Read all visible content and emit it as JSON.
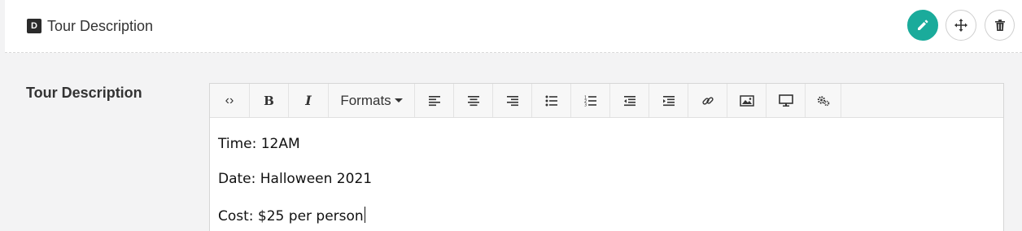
{
  "header": {
    "badge": "D",
    "title": "Tour Description",
    "buttons": {
      "edit": "pencil-icon",
      "move": "move-arrows-icon",
      "delete": "trash-icon"
    },
    "accent": "#1aab9b"
  },
  "field": {
    "label": "Tour Description",
    "toolbar": {
      "code": "‹›",
      "bold": "B",
      "italic": "I",
      "formats": "Formats",
      "icons": [
        "align-left-icon",
        "align-center-icon",
        "align-right-icon",
        "bullet-list-icon",
        "numbered-list-icon",
        "outdent-icon",
        "indent-icon",
        "link-icon",
        "image-icon",
        "embed-media-icon",
        "settings-icon"
      ]
    },
    "lines": [
      "Time: 12AM",
      "Date: Halloween 2021",
      "Cost: $25 per person"
    ]
  }
}
